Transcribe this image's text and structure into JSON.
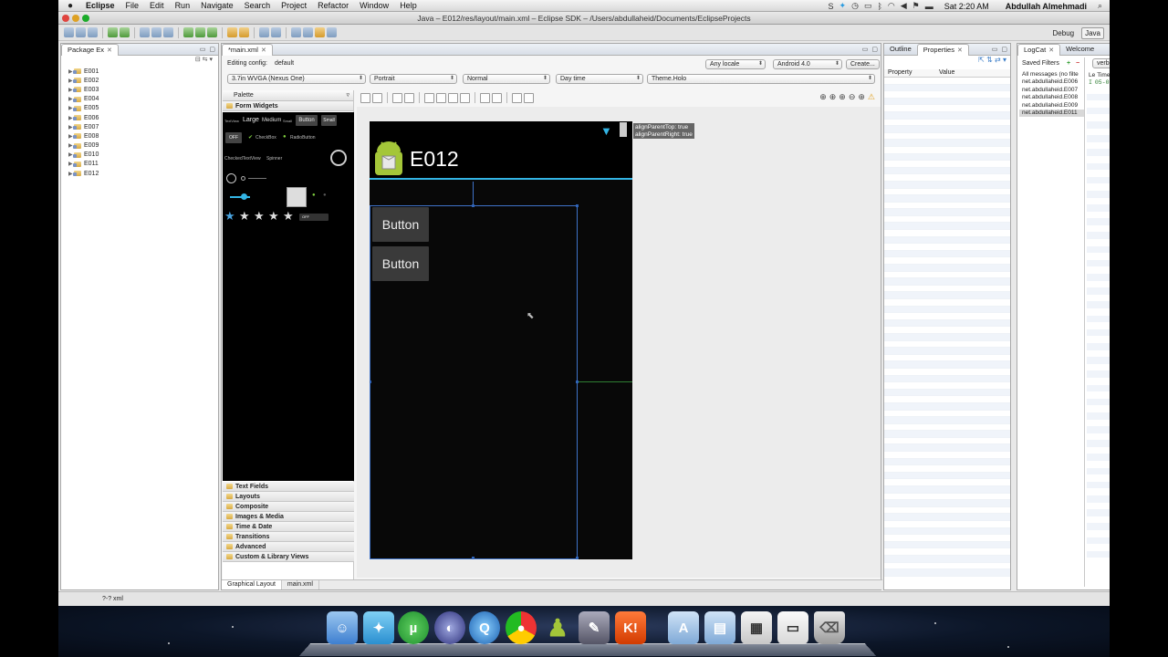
{
  "menubar": {
    "app": "Eclipse",
    "items": [
      "File",
      "Edit",
      "Run",
      "Navigate",
      "Search",
      "Project",
      "Refactor",
      "Window",
      "Help"
    ],
    "clock": "Sat 2:20 AM",
    "user": "Abdullah Almehmadi"
  },
  "window": {
    "title": "Java – E012/res/layout/main.xml – Eclipse SDK – /Users/abdullaheid/Documents/EclipseProjects"
  },
  "perspectives": {
    "debug": "Debug",
    "java": "Java"
  },
  "package_explorer": {
    "tab": "Package Ex",
    "projects": [
      "E001",
      "E002",
      "E003",
      "E004",
      "E005",
      "E006",
      "E007",
      "E008",
      "E009",
      "E010",
      "E011",
      "E012"
    ]
  },
  "editor": {
    "tab": "*main.xml",
    "editing_config_label": "Editing config:",
    "editing_config_value": "default",
    "locale": "Any locale",
    "api": "Android 4.0",
    "create": "Create...",
    "device": "3.7in WVGA (Nexus One)",
    "orientation": "Portrait",
    "dock_mode": "Normal",
    "night_mode": "Day time",
    "theme": "Theme.Holo",
    "bottom_tabs": [
      "Graphical Layout",
      "main.xml"
    ]
  },
  "palette": {
    "title": "Palette",
    "open_category": "Form Widgets",
    "categories": [
      "Text Fields",
      "Layouts",
      "Composite",
      "Images & Media",
      "Time & Date",
      "Transitions",
      "Advanced",
      "Custom & Library Views"
    ],
    "preview": {
      "textview": "TextView",
      "large": "Large",
      "medium": "Medium",
      "small": "Small",
      "button": "Button",
      "small_btn": "Small",
      "off": "OFF",
      "checkbox": "CheckBox",
      "radiobutton": "RadioButton",
      "checkedtextview": "CheckedTextView",
      "spinner": "Spinner",
      "switch_off": "OFF"
    }
  },
  "device_preview": {
    "app_title": "E012",
    "buttons": [
      "Button",
      "Button"
    ],
    "hint": "alignParentTop: true\nalignParentRight: true"
  },
  "properties": {
    "tabs": [
      "Outline",
      "Properties"
    ],
    "col_property": "Property",
    "col_value": "Value"
  },
  "logcat": {
    "tabs": [
      "LogCat",
      "Welcome"
    ],
    "saved_filters": "Saved Filters",
    "level": "verbose",
    "filters": [
      "All messages (no filte",
      "net.abdullaheid.E006",
      "net.abdullaheid.E007",
      "net.abdullaheid.E008",
      "net.abdullaheid.E009",
      "net.abdullaheid.E011"
    ],
    "col_level": "Le",
    "col_time": "Time",
    "entry_level": "I",
    "entry_time": "05-05 01:32:09."
  },
  "statusbar": {
    "text": "?-? xml"
  },
  "colors": {
    "holo_blue": "#33b5e5",
    "selection": "#3f73c9"
  }
}
